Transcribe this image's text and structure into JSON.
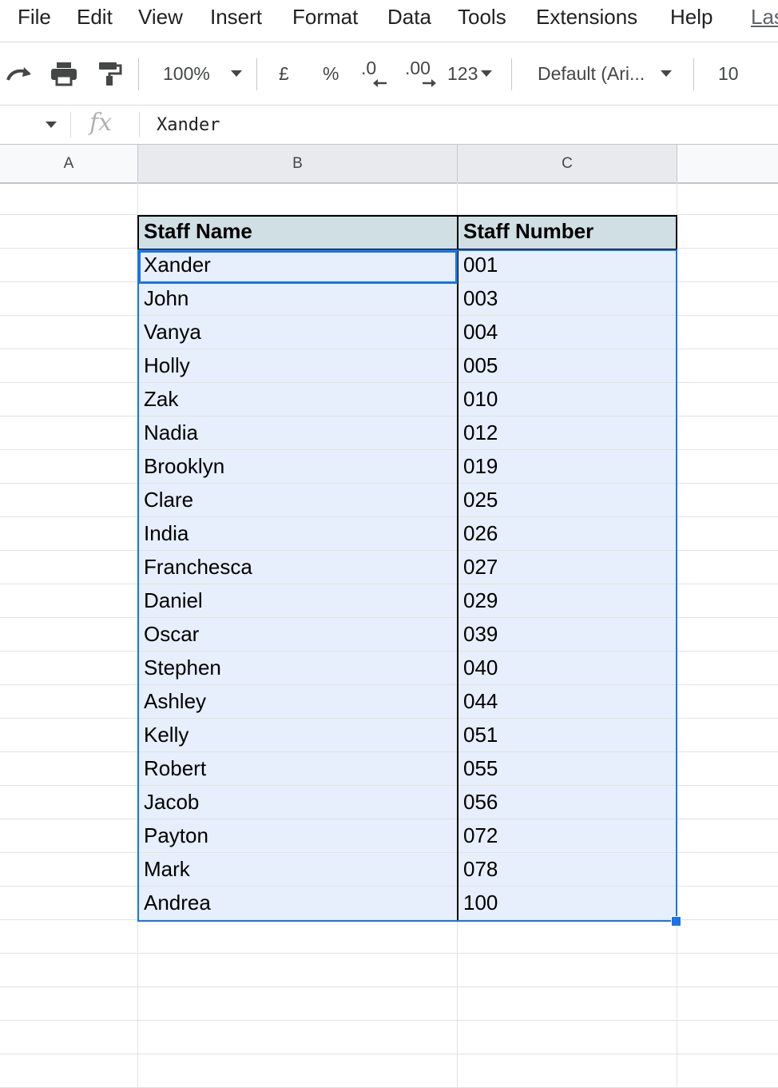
{
  "menu": {
    "file": "File",
    "edit": "Edit",
    "view": "View",
    "insert": "Insert",
    "format": "Format",
    "data": "Data",
    "tools": "Tools",
    "extensions": "Extensions",
    "help": "Help",
    "last_edit": "Las"
  },
  "toolbar": {
    "zoom": "100%",
    "currency": "£",
    "percent": "%",
    "decrease_decimals": ".0",
    "increase_decimals": ".00",
    "number_format": "123",
    "font": "Default (Ari...",
    "font_size": "10"
  },
  "formula_bar": {
    "fx": "fx",
    "value": "Xander"
  },
  "columns": [
    "A",
    "B",
    "C"
  ],
  "table": {
    "headers": [
      "Staff Name",
      "Staff Number"
    ],
    "rows": [
      [
        "Xander",
        "001"
      ],
      [
        "John",
        "003"
      ],
      [
        "Vanya",
        "004"
      ],
      [
        "Holly",
        "005"
      ],
      [
        "Zak",
        "010"
      ],
      [
        "Nadia",
        "012"
      ],
      [
        "Brooklyn",
        "019"
      ],
      [
        "Clare",
        "025"
      ],
      [
        "India",
        "026"
      ],
      [
        "Franchesca",
        "027"
      ],
      [
        "Daniel",
        "029"
      ],
      [
        "Oscar",
        "039"
      ],
      [
        "Stephen",
        "040"
      ],
      [
        "Ashley",
        "044"
      ],
      [
        "Kelly",
        "051"
      ],
      [
        "Robert",
        "055"
      ],
      [
        "Jacob",
        "056"
      ],
      [
        "Payton",
        "072"
      ],
      [
        "Mark",
        "078"
      ],
      [
        "Andrea",
        "100"
      ]
    ]
  },
  "colors": {
    "header_fill": "#d0dfe3",
    "selection_fill": "#e6effb",
    "selection_border": "#1a73e8"
  }
}
